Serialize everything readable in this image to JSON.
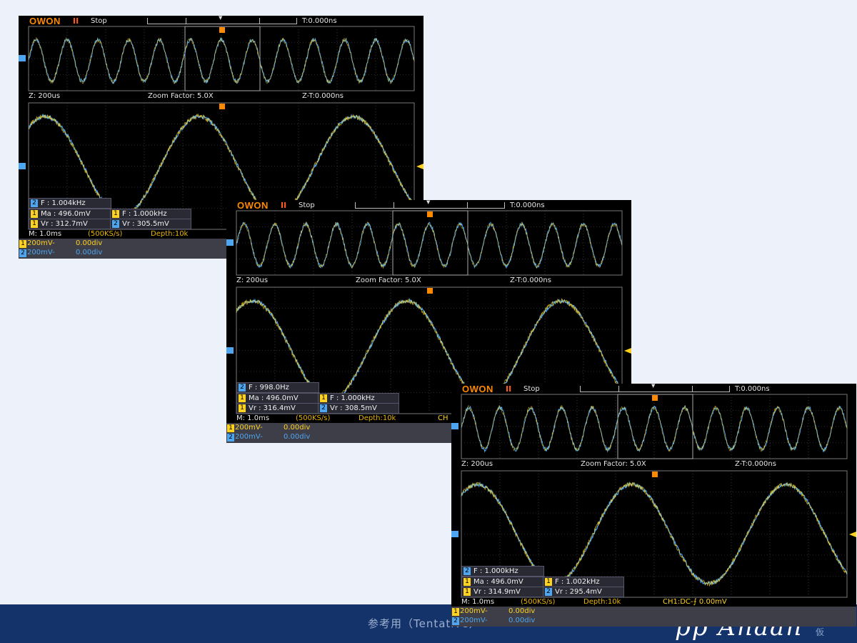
{
  "page": {
    "caption": "参考用（Tentative）",
    "signature": "pp Anaan",
    "corner_mark": "仮"
  },
  "scopes": [
    {
      "brand": "OWON",
      "status": "Stop",
      "trig_time": "T:0.000ns",
      "zoom_time": "Z: 200us",
      "zoom_factor": "Zoom Factor: 5.0X",
      "zoom_trig": "Z-T:0.000ns",
      "timebase": "M: 1.0ms",
      "samplerate": "(500KS/s)",
      "depth": "Depth:10k",
      "trigger_setting": "",
      "measurements": {
        "r1": {
          "ch": "2",
          "text": "F : 1.004kHz"
        },
        "r2a": {
          "ch": "1",
          "text": "Ma : 496.0mV"
        },
        "r2b": {
          "ch": "1",
          "text": "F : 1.000kHz"
        },
        "r3a": {
          "ch": "1",
          "text": "Vr : 312.7mV"
        },
        "r3b": {
          "ch": "2",
          "text": "Vr : 305.5mV"
        }
      },
      "channels": [
        {
          "ch": "1",
          "volts": "200mV-",
          "offset": "0.00div"
        },
        {
          "ch": "2",
          "volts": "200mV-",
          "offset": "0.00div"
        }
      ],
      "zoom_cycles": 2.5,
      "overview_cycles": 12.5
    },
    {
      "brand": "OWON",
      "status": "Stop",
      "trig_time": "T:0.000ns",
      "zoom_time": "Z: 200us",
      "zoom_factor": "Zoom Factor: 5.0X",
      "zoom_trig": "Z-T:0.000ns",
      "timebase": "M: 1.0ms",
      "samplerate": "(500KS/s)",
      "depth": "Depth:10k",
      "trigger_setting": "CH",
      "measurements": {
        "r1": {
          "ch": "2",
          "text": "F : 998.0Hz"
        },
        "r2a": {
          "ch": "1",
          "text": "Ma : 496.0mV"
        },
        "r2b": {
          "ch": "1",
          "text": "F : 1.000kHz"
        },
        "r3a": {
          "ch": "1",
          "text": "Vr : 316.4mV"
        },
        "r3b": {
          "ch": "2",
          "text": "Vr : 308.5mV"
        }
      },
      "channels": [
        {
          "ch": "1",
          "volts": "200mV-",
          "offset": "0.00div"
        },
        {
          "ch": "2",
          "volts": "200mV-",
          "offset": "0.00div"
        }
      ],
      "zoom_cycles": 2.5,
      "overview_cycles": 12.5
    },
    {
      "brand": "OWON",
      "status": "Stop",
      "trig_time": "T:0.000ns",
      "zoom_time": "Z: 200us",
      "zoom_factor": "Zoom Factor: 5.0X",
      "zoom_trig": "Z-T:0.000ns",
      "timebase": "M: 1.0ms",
      "samplerate": "(500KS/s)",
      "depth": "Depth:10k",
      "trigger_setting": "CH1:DC-⨍ 0.00mV",
      "measurements": {
        "r1": {
          "ch": "2",
          "text": "F : 1.000kHz"
        },
        "r2a": {
          "ch": "1",
          "text": "Ma : 496.0mV"
        },
        "r2b": {
          "ch": "1",
          "text": "F : 1.002kHz"
        },
        "r3a": {
          "ch": "1",
          "text": "Vr : 314.9mV"
        },
        "r3b": {
          "ch": "2",
          "text": "Vr : 295.4mV"
        }
      },
      "channels": [
        {
          "ch": "1",
          "volts": "200mV-",
          "offset": "0.00div"
        },
        {
          "ch": "2",
          "volts": "200mV-",
          "offset": "0.00div"
        }
      ],
      "zoom_cycles": 2.5,
      "overview_cycles": 12.5
    }
  ],
  "colors": {
    "ch1": "#ffd21f",
    "ch2": "#4ea6f0",
    "grid": "#5a5a5a",
    "brand": "#ff8a00"
  }
}
